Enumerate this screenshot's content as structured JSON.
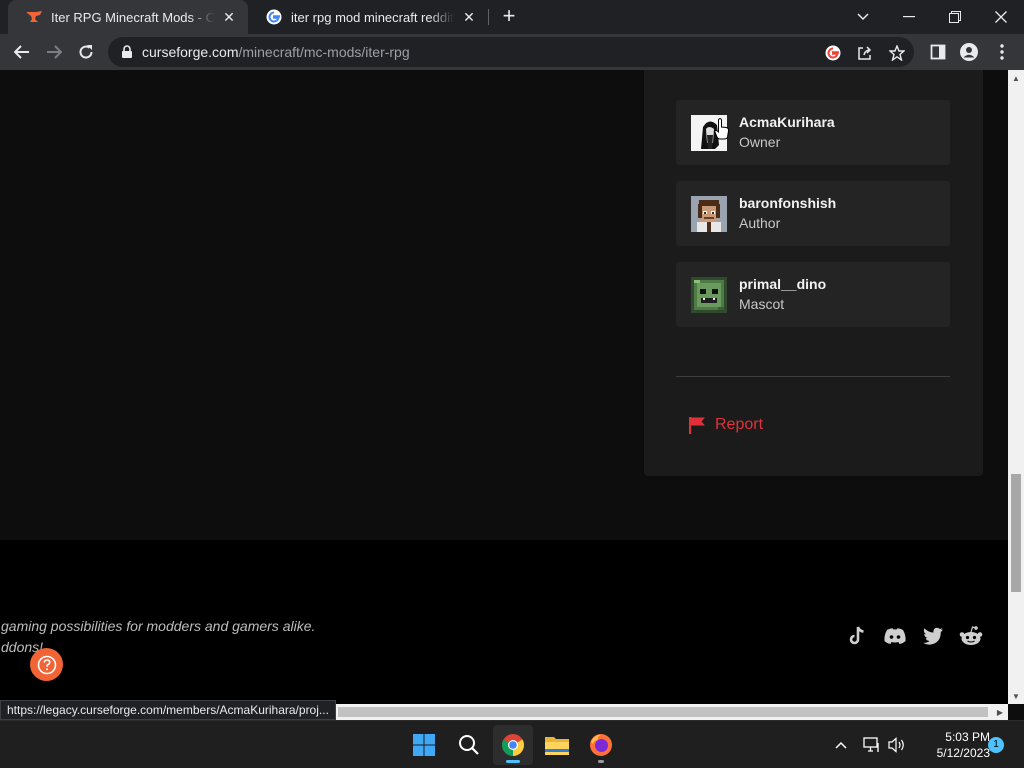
{
  "browser": {
    "tabs": [
      {
        "title": "Iter RPG Minecraft Mods - CurseForge",
        "close": "✕"
      },
      {
        "title": "iter rpg mod minecraft reddit - Google Search",
        "close": "✕"
      }
    ],
    "new_tab": "+",
    "url_host": "curseforge.com",
    "url_path": "/minecraft/mc-mods/iter-rpg",
    "status_url": "https://legacy.curseforge.com/members/AcmaKurihara/proj..."
  },
  "members": [
    {
      "name": "AcmaKurihara",
      "role": "Owner"
    },
    {
      "name": "baronfonshish",
      "role": "Author"
    },
    {
      "name": "primal__dino",
      "role": "Mascot"
    }
  ],
  "report_label": "Report",
  "footer": {
    "tagline_1": "gaming possibilities for modders and gamers alike.",
    "tagline_2": "ddons!",
    "social_icons": [
      "tiktok-icon",
      "discord-icon",
      "twitter-icon",
      "reddit-icon"
    ]
  },
  "taskbar": {
    "time": "5:03 PM",
    "date": "5/12/2023",
    "notifications": "1"
  },
  "colors": {
    "report_red": "#e0313b",
    "help_orange": "#f16436",
    "panel_bg": "#1b1b1b",
    "card_bg": "#242424"
  }
}
